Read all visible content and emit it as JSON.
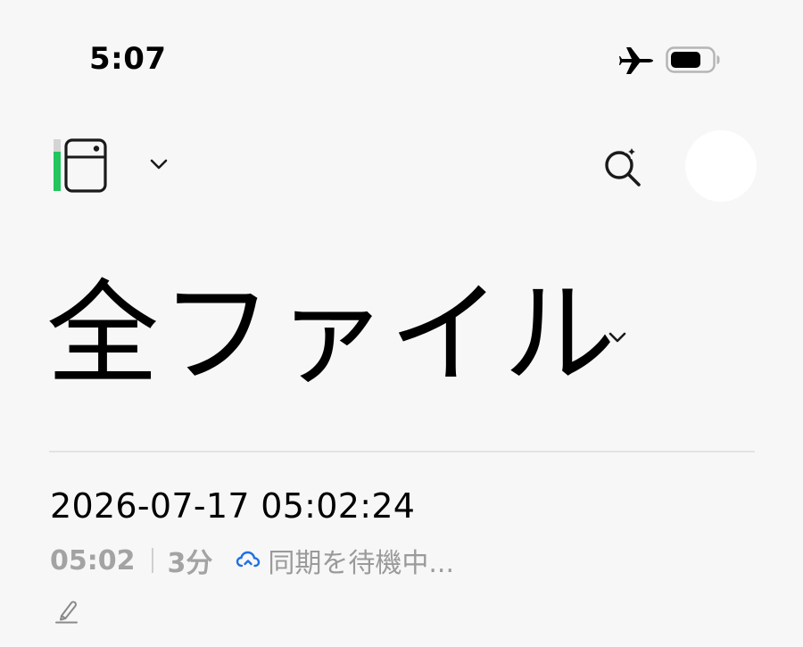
{
  "status_bar": {
    "time": "5:07",
    "icons": [
      "airplane-mode-icon",
      "battery-icon"
    ]
  },
  "toolbar": {
    "left_icon": "notebook-icon",
    "left_chevron": "chevron-down-icon",
    "search_icon": "ai-search-icon",
    "avatar": "avatar"
  },
  "page": {
    "title": "全ファイル",
    "title_chevron": "chevron-down-icon"
  },
  "notes": [
    {
      "title": "2026-07-17 05:02:24",
      "time": "05:02",
      "duration": "3分",
      "sync_icon": "cloud-sync-icon",
      "sync_status": "同期を待機中...",
      "type_icon": "pen-icon"
    }
  ],
  "colors": {
    "background": "#f7f7f7",
    "accent_green": "#22c55e",
    "sync_blue": "#1f6fe5",
    "meta_gray": "#a3a3a3",
    "divider": "#e3e3e3"
  }
}
